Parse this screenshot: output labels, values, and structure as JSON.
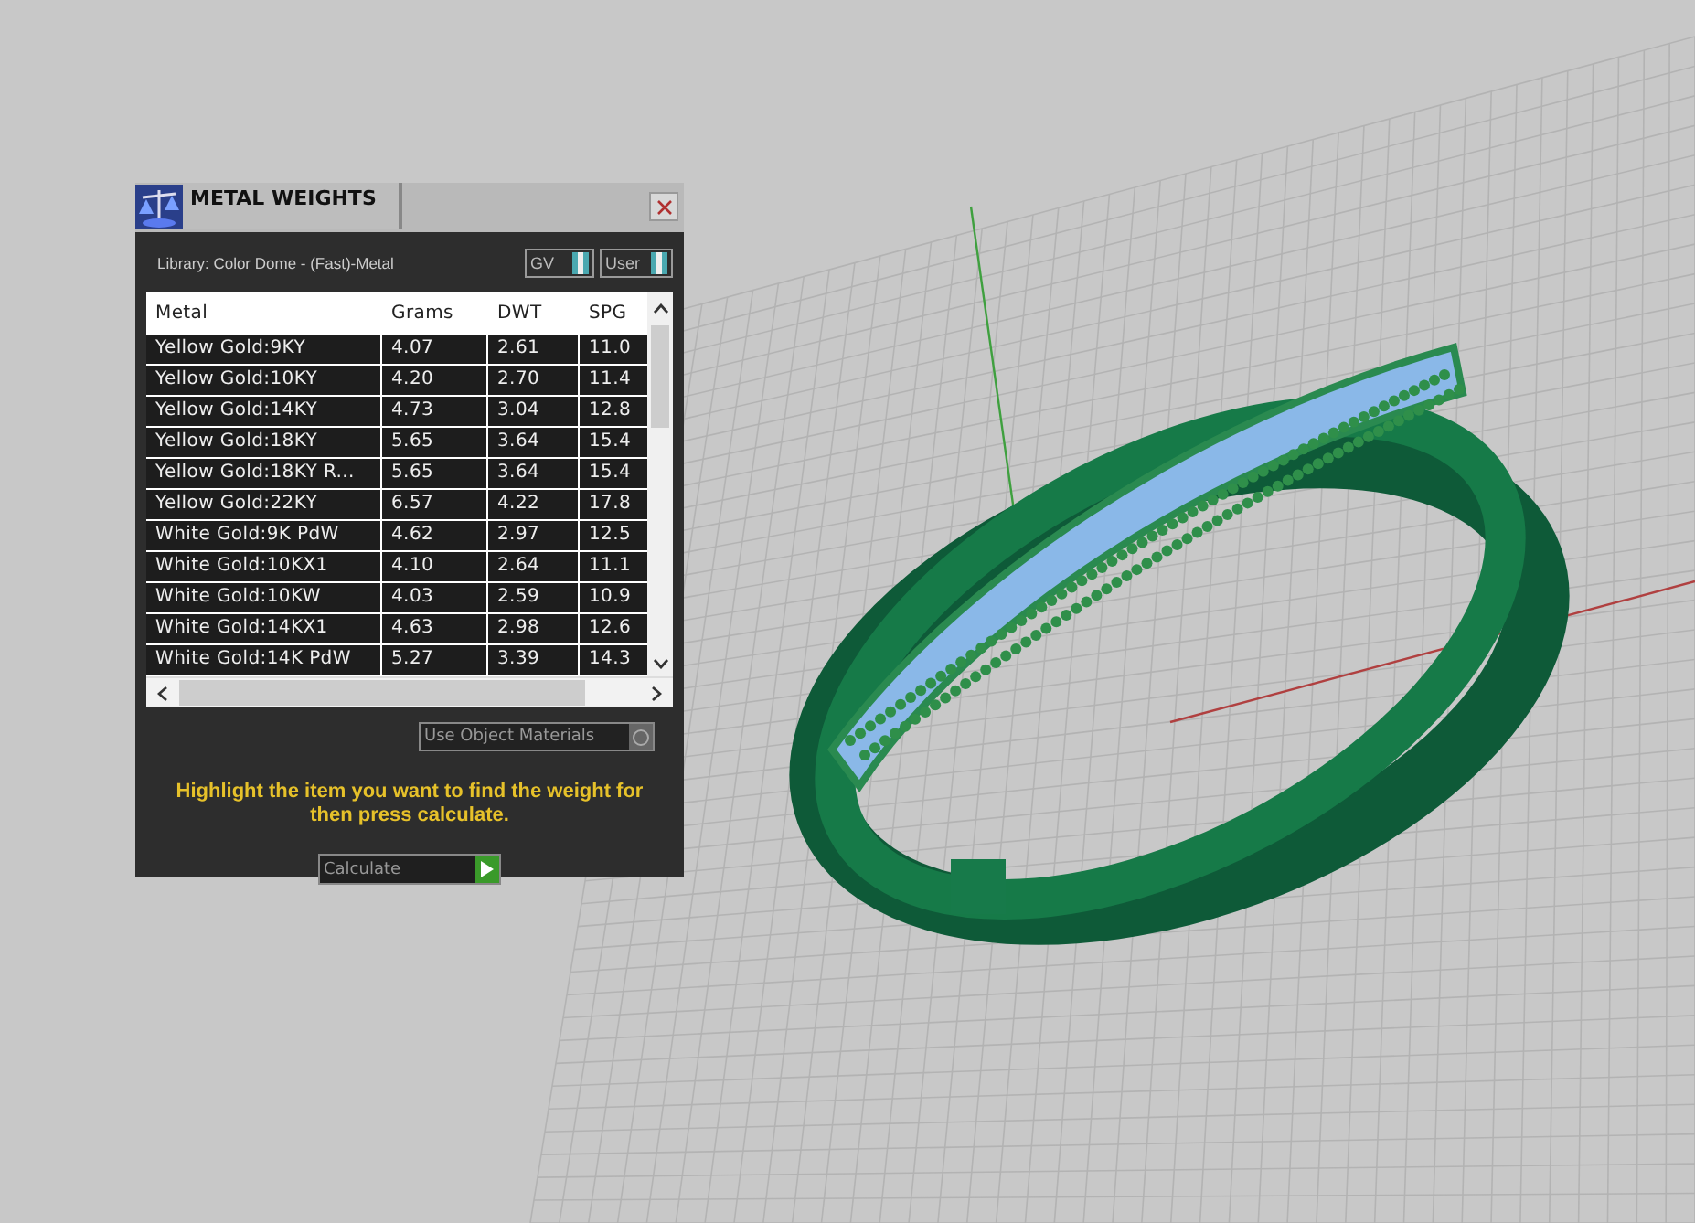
{
  "dialog": {
    "title": "METAL WEIGHTS",
    "library": "Library: Color Dome - (Fast)-Metal",
    "toggles": [
      {
        "label": "GV",
        "on": true
      },
      {
        "label": "User",
        "on": true
      }
    ],
    "table": {
      "columns": [
        "Metal",
        "Grams",
        "DWT",
        "SPG"
      ],
      "rows": [
        [
          "Yellow Gold:9KY",
          "4.07",
          "2.61",
          "11.0"
        ],
        [
          "Yellow Gold:10KY",
          "4.20",
          "2.70",
          "11.4"
        ],
        [
          "Yellow Gold:14KY",
          "4.73",
          "3.04",
          "12.8"
        ],
        [
          "Yellow Gold:18KY",
          "5.65",
          "3.64",
          "15.4"
        ],
        [
          "Yellow Gold:18KY R...",
          "5.65",
          "3.64",
          "15.4"
        ],
        [
          "Yellow Gold:22KY",
          "6.57",
          "4.22",
          "17.8"
        ],
        [
          "White Gold:9K PdW",
          "4.62",
          "2.97",
          "12.5"
        ],
        [
          "White Gold:10KX1",
          "4.10",
          "2.64",
          "11.1"
        ],
        [
          "White Gold:10KW",
          "4.03",
          "2.59",
          "10.9"
        ],
        [
          "White Gold:14KX1",
          "4.63",
          "2.98",
          "12.6"
        ],
        [
          "White Gold:14K PdW",
          "5.27",
          "3.39",
          "14.3"
        ]
      ]
    },
    "use_object_materials": {
      "label": "Use Object Materials",
      "checked": false
    },
    "instruction": "Highlight the item you want to find the weight for then press calculate.",
    "calculate_button": "Calculate"
  }
}
